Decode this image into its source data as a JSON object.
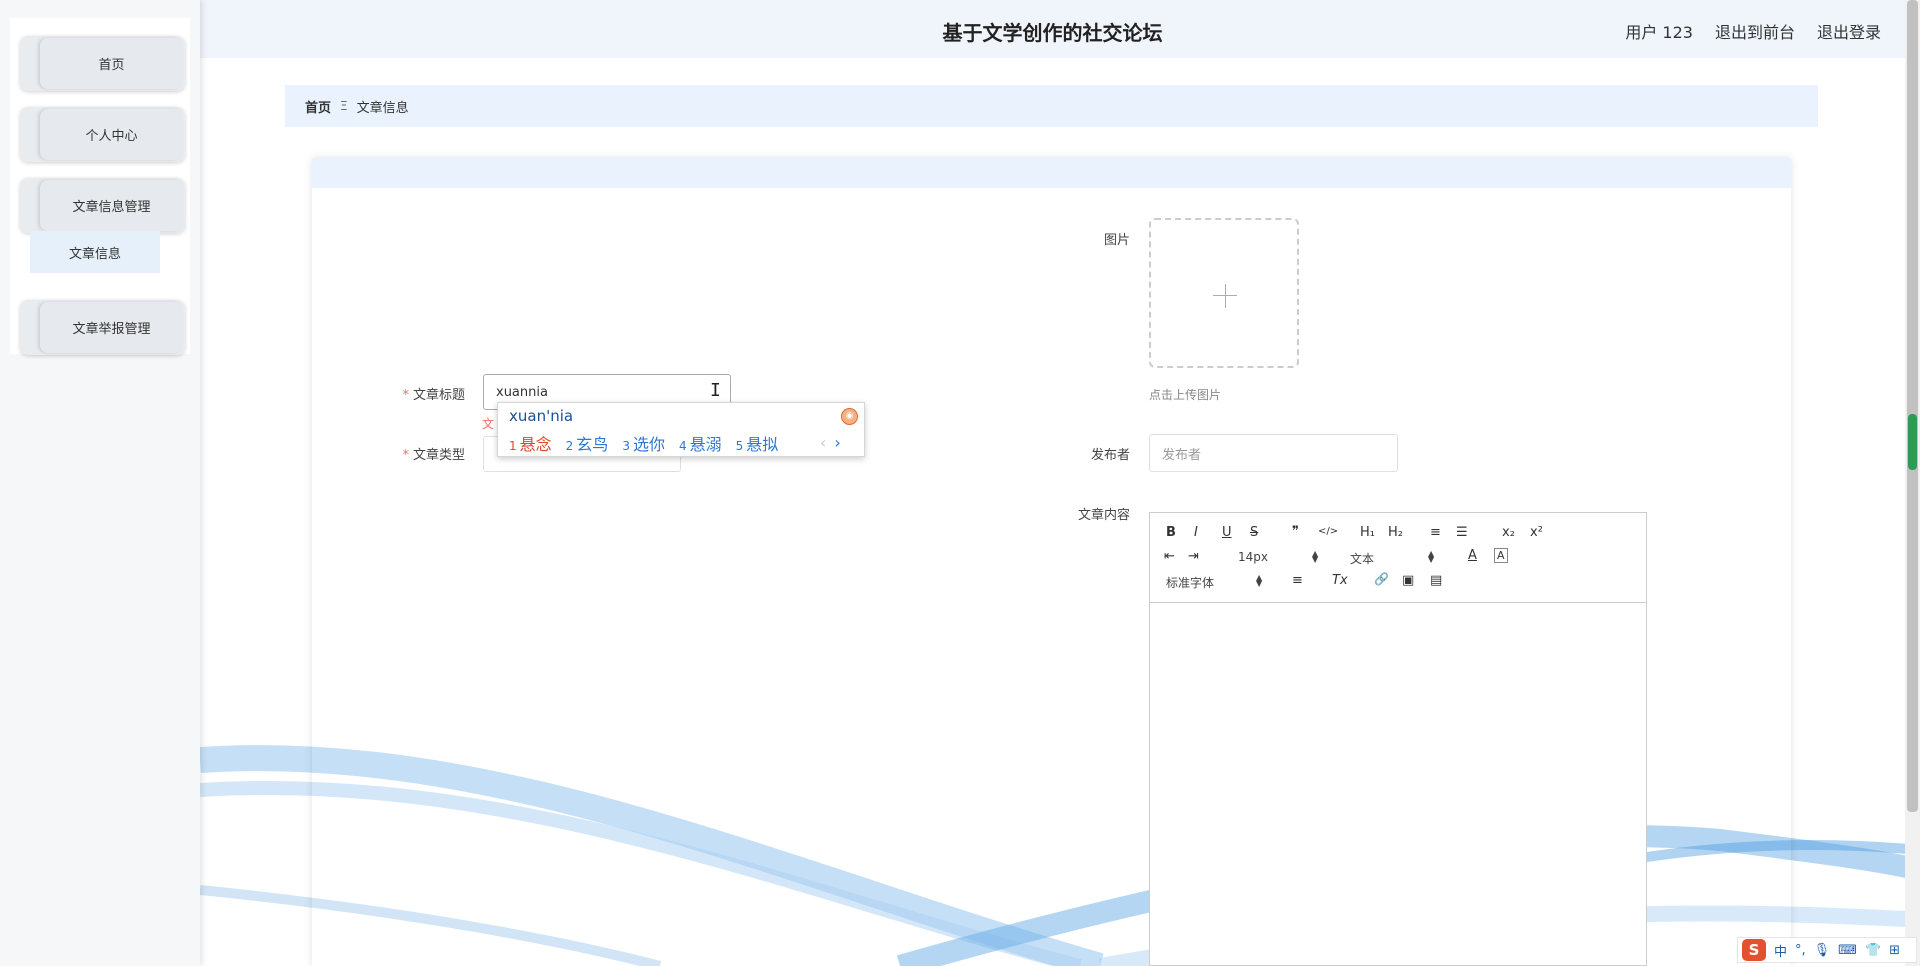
{
  "header": {
    "site_title": "基于文学创作的社交论坛",
    "user_label": "用户 123",
    "back_to_front": "退出到前台",
    "logout": "退出登录"
  },
  "sidebar": {
    "items": [
      {
        "label": "首页"
      },
      {
        "label": "个人中心"
      },
      {
        "label": "文章信息管理"
      },
      {
        "label": "文章举报管理"
      }
    ],
    "submenu": {
      "label": "文章信息"
    }
  },
  "breadcrumb": {
    "home": "首页",
    "separator": "Ξ",
    "current": "文章信息"
  },
  "form": {
    "title_label": "文章标题",
    "title_value": "xuannia",
    "title_error": "文",
    "type_label": "文章类型",
    "image_label": "图片",
    "upload_tip": "点击上传图片",
    "publisher_label": "发布者",
    "publisher_placeholder": "发布者",
    "content_label": "文章内容",
    "required_mark": "*"
  },
  "editor": {
    "toolbar": {
      "bold": "B",
      "italic": "I",
      "underline": "U",
      "strike": "S",
      "quote": "❞",
      "code": "</>",
      "h1": "H₁",
      "h2": "H₂",
      "ordered_list": "≡",
      "bullet_list": "☰",
      "subscript": "x₂",
      "superscript": "x²",
      "outdent": "⇤",
      "indent": "⇥",
      "font_size": "14px",
      "header_select": "文本",
      "font_color": "A",
      "bg_color": "A",
      "font_family": "标准字体",
      "align": "≡",
      "clean": "Tx",
      "link": "🔗",
      "image": "▣",
      "video": "▤"
    }
  },
  "ime": {
    "pinyin": "xuan'nia",
    "candidates": [
      {
        "num": "1",
        "text": "悬念"
      },
      {
        "num": "2",
        "text": "玄鸟"
      },
      {
        "num": "3",
        "text": "选你"
      },
      {
        "num": "4",
        "text": "悬溺"
      },
      {
        "num": "5",
        "text": "悬拟"
      }
    ],
    "prev": "‹",
    "next": "›"
  },
  "tray": {
    "logo": "S",
    "lang": "中",
    "punct": "°,",
    "mic": "🎙",
    "keyboard": "⌨",
    "skin": "👕",
    "menu": "⊞"
  }
}
